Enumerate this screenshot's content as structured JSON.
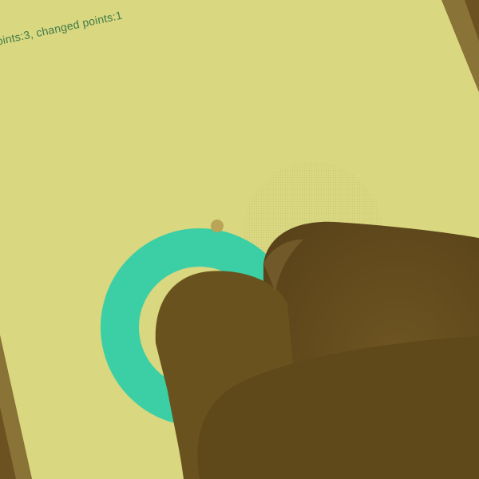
{
  "status": {
    "text": "oints:3, changed points:1"
  },
  "colors": {
    "screen": "#d9d77f",
    "bezel": "#6b5220",
    "ring": "#3ccfa5",
    "ring_fade": "#c9c77a",
    "finger": "#6a521f",
    "finger_shadow": "#5b4419",
    "touch_dot": "#b9a457",
    "status_text": "#3f7a4a"
  },
  "icons": {
    "touch_point": "circle-dot-icon"
  }
}
